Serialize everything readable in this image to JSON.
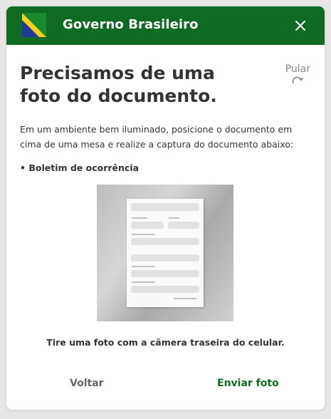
{
  "header": {
    "title": "Governo Brasileiro",
    "logo_icon": "brazil-flag-logo",
    "close_icon": "close-icon"
  },
  "content": {
    "heading": "Precisamos de uma foto do documento.",
    "skip_label": "Pular",
    "skip_icon": "redo-arrow-icon",
    "instructions": "Em um ambiente bem iluminado, posicione o documento em cima de uma mesa e realize a captura do documento abaixo:",
    "document_type": "• Boletim de ocorrência",
    "illustration_icon": "document-illustration",
    "caption": "Tire uma foto com a câmera traseira do celular."
  },
  "footer": {
    "back_label": "Voltar",
    "send_label": "Enviar foto"
  },
  "colors": {
    "brand_green": "#0f6b22",
    "text": "#333333",
    "muted": "#8a8a8a"
  }
}
